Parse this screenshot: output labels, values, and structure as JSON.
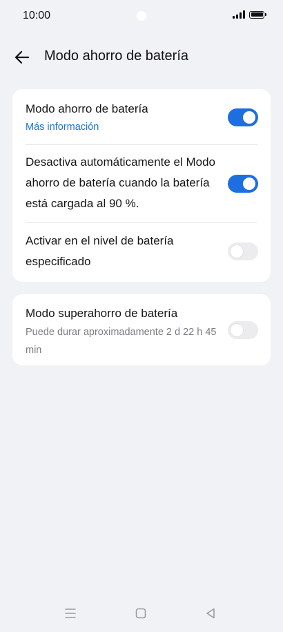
{
  "status_bar": {
    "time": "10:00",
    "icons": [
      "signal-icon",
      "battery-icon"
    ]
  },
  "header": {
    "back_icon": "arrow-left-icon",
    "title": "Modo ahorro de batería"
  },
  "settings": {
    "battery_saver": {
      "label": "Modo ahorro de batería",
      "link": "Más información",
      "enabled": true
    },
    "auto_disable": {
      "label": "Desactiva automáticamente el Modo ahorro de batería cuando la batería está cargada al 90 %.",
      "enabled": true
    },
    "activate_at_level": {
      "label": "Activar en el nivel de batería especificado",
      "enabled": false
    },
    "super_saver": {
      "label": "Modo superahorro de batería",
      "description": "Puede durar aproximadamente 2 d 22 h 45 min",
      "enabled": false
    }
  },
  "navigation_bar": {
    "icons": [
      "menu-icon",
      "home-icon",
      "back-triangle-icon"
    ]
  },
  "colors": {
    "accent": "#1d6fe0",
    "link": "#1c74d6",
    "background": "#f1f2f5",
    "card": "#ffffff"
  }
}
